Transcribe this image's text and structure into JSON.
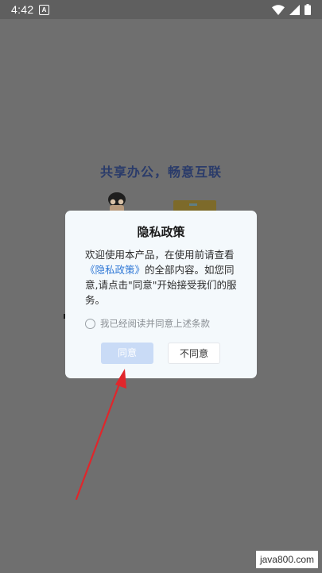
{
  "status_bar": {
    "time": "4:42",
    "notification_letter": "A",
    "icons": [
      "wifi-icon",
      "signal-icon",
      "battery-icon"
    ]
  },
  "background_app": {
    "slogan": "共享办公，畅意互联"
  },
  "dialog": {
    "title": "隐私政策",
    "body_prefix": "欢迎使用本产品，在使用前请查看",
    "policy_link": "《隐私政策》",
    "body_suffix": "的全部内容。如您同意,请点击\"同意\"开始接受我们的服务。",
    "checkbox_label": "我已经阅读并同意上述条款",
    "checkbox_checked": false,
    "agree_button": "同意",
    "disagree_button": "不同意"
  },
  "watermark": "java800.com",
  "colors": {
    "overlay": "#6f6f6f",
    "dialog_bg": "#f4f9fc",
    "link": "#2f78d6",
    "agree_button_bg": "#c9dbf6",
    "annotation_arrow": "#e0262b"
  }
}
